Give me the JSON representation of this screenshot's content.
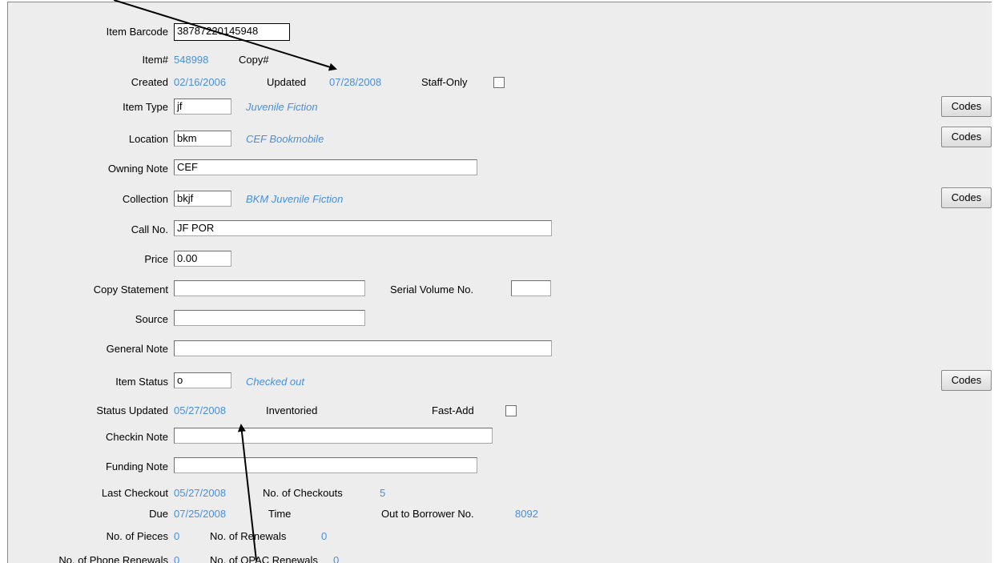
{
  "form": {
    "item_barcode": {
      "label": "Item Barcode",
      "value": "38787220145948"
    },
    "item_no": {
      "label": "Item#",
      "value": "548998"
    },
    "copy_no": {
      "label": "Copy#"
    },
    "created": {
      "label": "Created",
      "value": "02/16/2006"
    },
    "updated": {
      "label": "Updated",
      "value": "07/28/2008"
    },
    "staff_only": {
      "label": "Staff-Only",
      "checked": false
    },
    "item_type": {
      "label": "Item Type",
      "value": "jf",
      "desc": "Juvenile Fiction"
    },
    "location": {
      "label": "Location",
      "value": "bkm",
      "desc": "CEF Bookmobile"
    },
    "owning_note": {
      "label": "Owning Note",
      "value": "CEF"
    },
    "collection": {
      "label": "Collection",
      "value": "bkjf",
      "desc": "BKM Juvenile Fiction"
    },
    "call_no": {
      "label": "Call No.",
      "value": "JF POR"
    },
    "price": {
      "label": "Price",
      "value": "0.00"
    },
    "copy_statement": {
      "label": "Copy Statement",
      "value": ""
    },
    "serial_volume": {
      "label": "Serial Volume No.",
      "value": ""
    },
    "source": {
      "label": "Source",
      "value": ""
    },
    "general_note": {
      "label": "General Note",
      "value": ""
    },
    "item_status": {
      "label": "Item Status",
      "value": "o",
      "desc": "Checked out"
    },
    "status_updated": {
      "label": "Status Updated",
      "value": "05/27/2008"
    },
    "inventoried": {
      "label": "Inventoried"
    },
    "fast_add": {
      "label": "Fast-Add",
      "checked": false
    },
    "checkin_note": {
      "label": "Checkin Note",
      "value": ""
    },
    "funding_note": {
      "label": "Funding Note",
      "value": ""
    },
    "last_checkout": {
      "label": "Last Checkout",
      "value": "05/27/2008"
    },
    "no_checkouts": {
      "label": "No. of Checkouts",
      "value": "5"
    },
    "due": {
      "label": "Due",
      "value": "07/25/2008"
    },
    "time": {
      "label": "Time"
    },
    "out_to_borrower": {
      "label": "Out to Borrower No.",
      "value": "8092"
    },
    "no_pieces": {
      "label": "No. of Pieces",
      "value": "0"
    },
    "no_renewals": {
      "label": "No. of Renewals",
      "value": "0"
    },
    "no_phone_renewals": {
      "label": "No. of Phone Renewals",
      "value": "0"
    },
    "no_opac_renewals": {
      "label": "No. of OPAC Renewals",
      "value": "0"
    }
  },
  "buttons": {
    "codes_label": "Codes"
  },
  "colors": {
    "value_text": "#4a90d9",
    "panel_bg": "#ededed",
    "annotation_arrow": "#000000"
  }
}
